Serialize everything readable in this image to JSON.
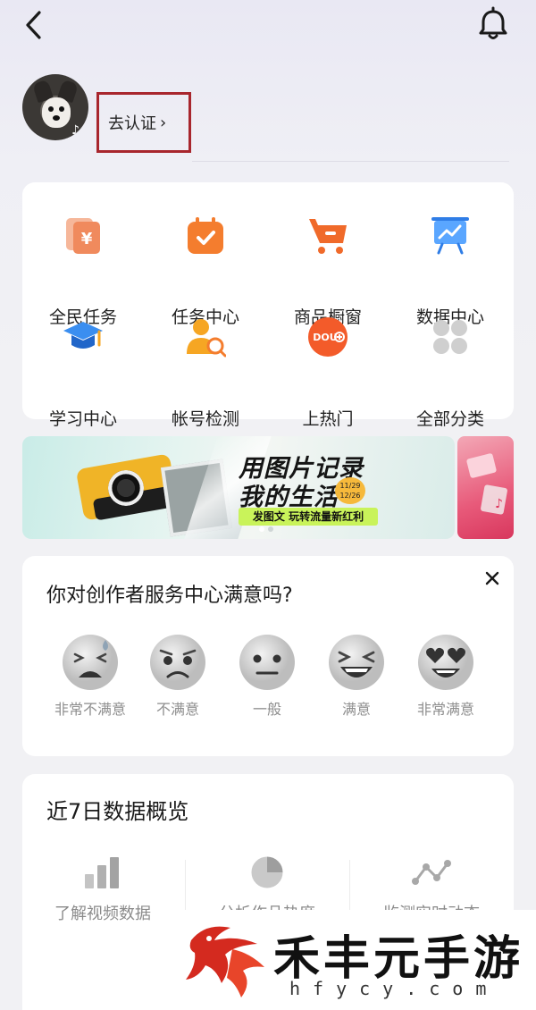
{
  "header": {
    "back_icon": "chevron-left-icon",
    "bell_icon": "bell-icon"
  },
  "profile": {
    "verify_label": "去认证",
    "verify_chevron": "›"
  },
  "tools": [
    {
      "label": "全民任务",
      "icon": "yuan-coupon-icon",
      "color": "#f08a5d"
    },
    {
      "label": "任务中心",
      "icon": "task-calendar-icon",
      "color": "#f47d2e"
    },
    {
      "label": "商品橱窗",
      "icon": "shopping-cart-icon",
      "color": "#f06a2a"
    },
    {
      "label": "数据中心",
      "icon": "presentation-chart-icon",
      "color": "#3d8ff5"
    },
    {
      "label": "学习中心",
      "icon": "graduation-cap-icon",
      "color": "#3a8ef0"
    },
    {
      "label": "帐号检测",
      "icon": "user-search-icon",
      "color": "#f6a623"
    },
    {
      "label": "上热门",
      "icon": "dou-plus-icon",
      "color": "#f35b2a"
    },
    {
      "label": "全部分类",
      "icon": "grid-dots-icon",
      "color": "#c9c9c9"
    }
  ],
  "banner": {
    "headline_1": "用图片记录",
    "headline_2": "我的生活",
    "date_top": "11/29",
    "date_bottom": "12/26",
    "cta": "发图文 玩转流量新红利"
  },
  "survey": {
    "title": "你对创作者服务中心满意吗?",
    "options": [
      {
        "label": "非常不满意",
        "icon": "very-unsatisfied-face-icon"
      },
      {
        "label": "不满意",
        "icon": "unsatisfied-face-icon"
      },
      {
        "label": "一般",
        "icon": "neutral-face-icon"
      },
      {
        "label": "满意",
        "icon": "satisfied-face-icon"
      },
      {
        "label": "非常满意",
        "icon": "heart-eyes-face-icon"
      }
    ]
  },
  "data_overview": {
    "title": "近7日数据概览",
    "metrics": [
      {
        "label": "了解视频数据",
        "icon": "bar-chart-icon"
      },
      {
        "label": "分析作品热度",
        "icon": "pie-chart-icon"
      },
      {
        "label": "监测实时动态",
        "icon": "line-trend-icon"
      }
    ]
  },
  "watermark": {
    "text": "禾丰元手游",
    "url": "hfycy.com"
  }
}
